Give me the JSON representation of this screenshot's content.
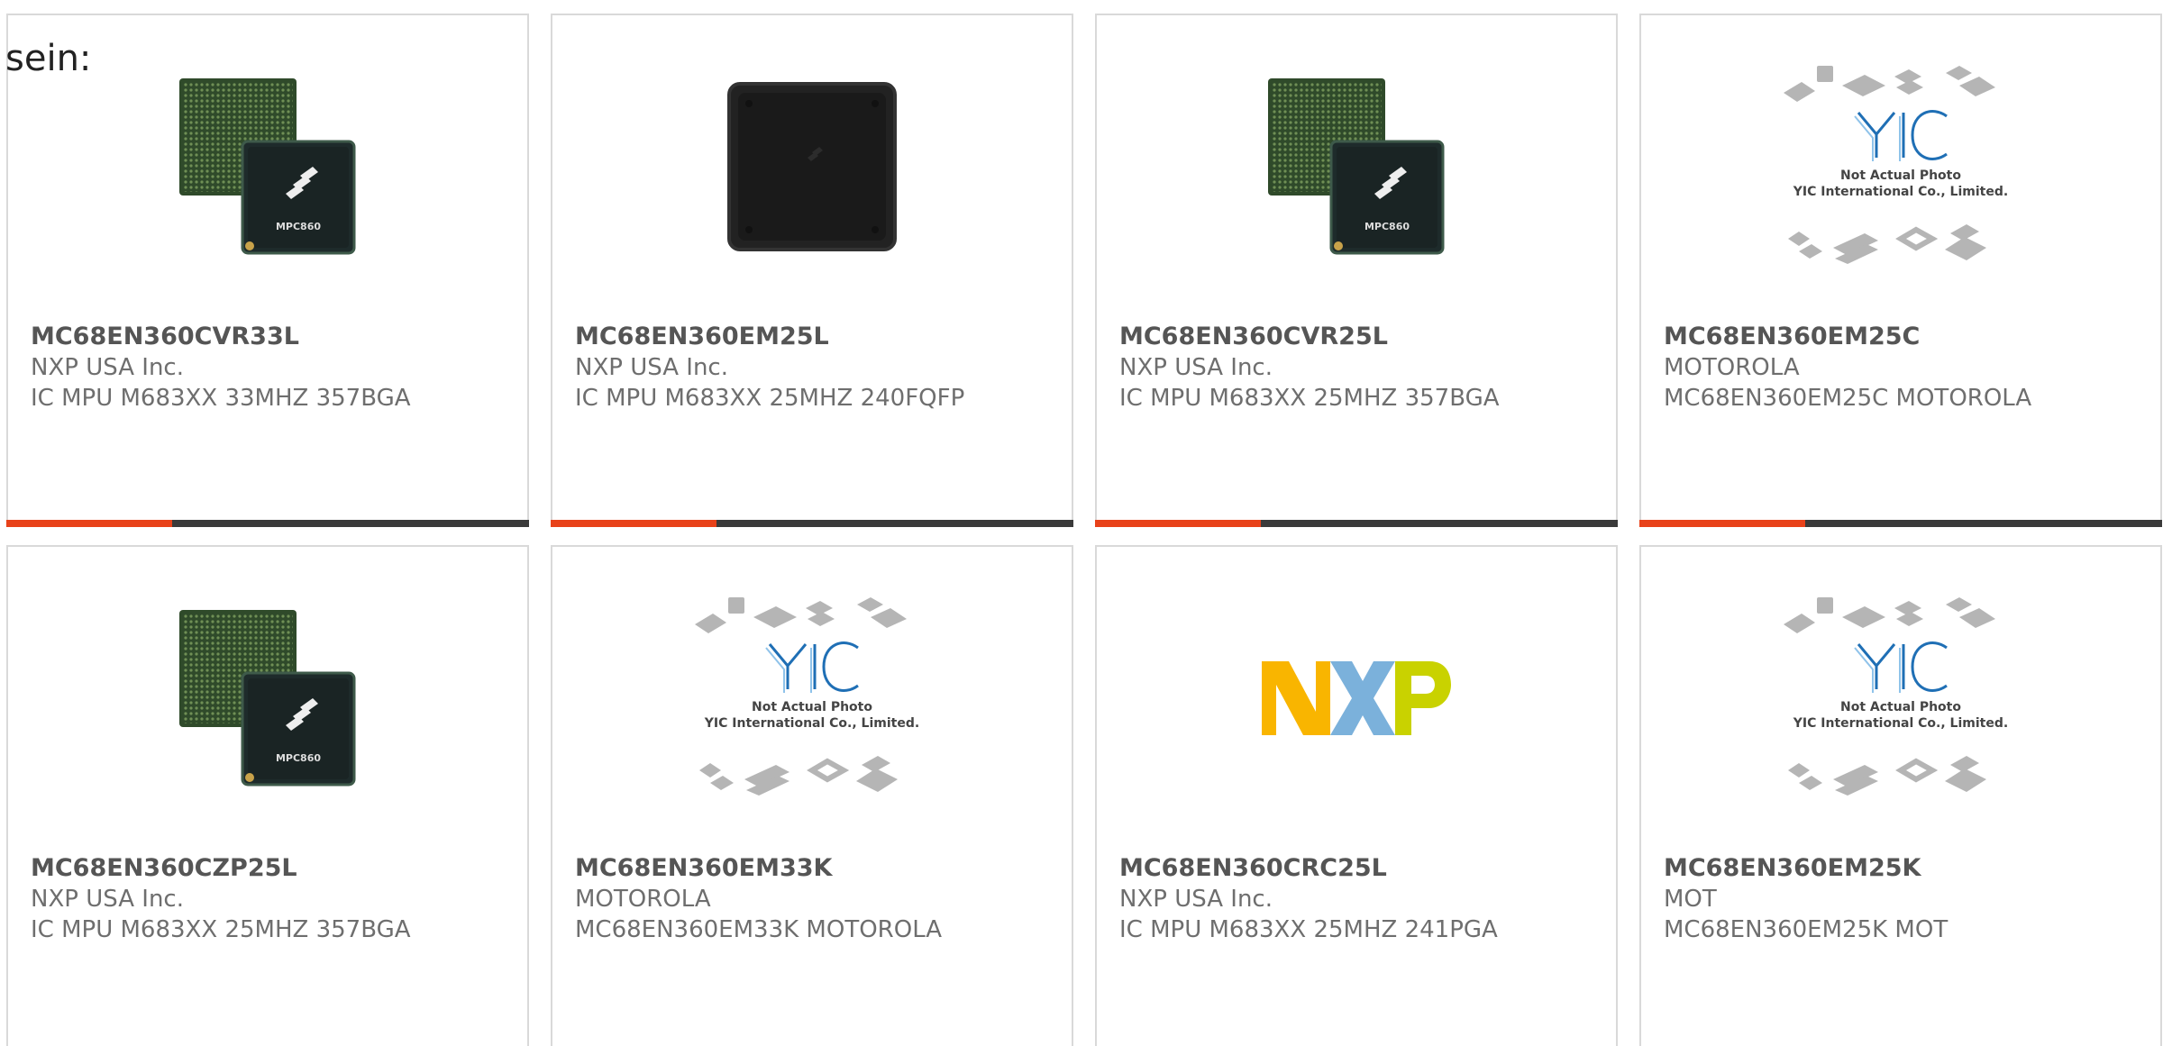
{
  "intro_text": "sein:",
  "colors": {
    "accent": "#e8421a",
    "bar": "#3a3a3a",
    "border": "#d9d9d9"
  },
  "products": [
    {
      "part_number": "MC68EN360CVR33L",
      "manufacturer": "NXP USA Inc.",
      "description": "IC MPU M683XX 33MHZ 357BGA",
      "image": "bga-chip",
      "chip_label": "MPC860"
    },
    {
      "part_number": "MC68EN360EM25L",
      "manufacturer": "NXP USA Inc.",
      "description": "IC MPU M683XX 25MHZ 240FQFP",
      "image": "qfp-chip"
    },
    {
      "part_number": "MC68EN360CVR25L",
      "manufacturer": "NXP USA Inc.",
      "description": "IC MPU M683XX 25MHZ 357BGA",
      "image": "bga-chip",
      "chip_label": "MPC860"
    },
    {
      "part_number": "MC68EN360EM25C",
      "manufacturer": "MOTOROLA",
      "description": "MC68EN360EM25C MOTOROLA",
      "image": "yic-placeholder",
      "placeholder_line1": "Not Actual Photo",
      "placeholder_line2": "YIC International Co., Limited."
    },
    {
      "part_number": "MC68EN360CZP25L",
      "manufacturer": "NXP USA Inc.",
      "description": "IC MPU M683XX 25MHZ 357BGA",
      "image": "bga-chip",
      "chip_label": "MPC860"
    },
    {
      "part_number": "MC68EN360EM33K",
      "manufacturer": "MOTOROLA",
      "description": "MC68EN360EM33K MOTOROLA",
      "image": "yic-placeholder",
      "placeholder_line1": "Not Actual Photo",
      "placeholder_line2": "YIC International Co., Limited."
    },
    {
      "part_number": "MC68EN360CRC25L",
      "manufacturer": "NXP USA Inc.",
      "description": "IC MPU M683XX 25MHZ 241PGA",
      "image": "nxp-logo"
    },
    {
      "part_number": "MC68EN360EM25K",
      "manufacturer": "MOT",
      "description": "MC68EN360EM25K MOT",
      "image": "yic-placeholder",
      "placeholder_line1": "Not Actual Photo",
      "placeholder_line2": "YIC International Co., Limited."
    }
  ]
}
